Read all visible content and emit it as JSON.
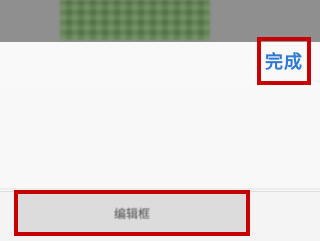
{
  "header": {
    "done_label": "完成"
  },
  "bottom": {
    "input_label": "编辑框"
  },
  "colors": {
    "accent": "#2f79d6",
    "highlight": "#c80000",
    "background": "#f8f8f8",
    "dim_overlay": "#8f8f8f"
  }
}
